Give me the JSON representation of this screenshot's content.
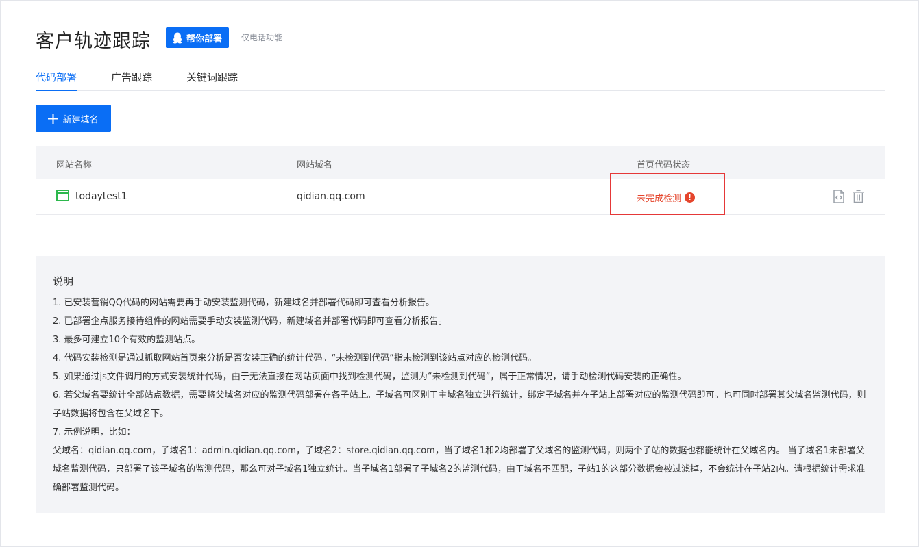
{
  "page": {
    "title": "客户轨迹跟踪",
    "deploy_button": "帮你部署",
    "phone_note": "仅电话功能"
  },
  "tabs": [
    {
      "label": "代码部署",
      "active": true
    },
    {
      "label": "广告跟踪",
      "active": false
    },
    {
      "label": "关键词跟踪",
      "active": false
    }
  ],
  "new_domain_button": "新建域名",
  "table": {
    "columns": [
      "网站名称",
      "网站域名",
      "首页代码状态"
    ],
    "rows": [
      {
        "name": "todaytest1",
        "domain": "qidian.qq.com",
        "status": "未完成检测",
        "status_icon": "warning-icon"
      }
    ]
  },
  "notes": {
    "title": "说明",
    "lines": [
      "1. 已安装营销QQ代码的网站需要再手动安装监测代码，新建域名并部署代码即可查看分析报告。",
      "2. 已部署企点服务接待组件的网站需要手动安装监测代码，新建域名并部署代码即可查看分析报告。",
      "3. 最多可建立10个有效的监测站点。",
      "4. 代码安装检测是通过抓取网站首页来分析是否安装正确的统计代码。“未检测到代码”指未检测到该站点对应的检测代码。",
      "5. 如果通过js文件调用的方式安装统计代码，由于无法直接在网站页面中找到检测代码，监测为“未检测到代码”，属于正常情况，请手动检测代码安装的正确性。",
      "6. 若父域名要统计全部站点数据，需要将父域名对应的监测代码部署在各子站上。子域名可区别于主域名独立进行统计，绑定子域名并在子站上部署对应的监测代码即可。也可同时部署其父域名监测代码，则子站数据将包含在父域名下。",
      "7. 示例说明，比如：",
      "父域名：qidian.qq.com，子域名1：admin.qidian.qq.com，子域名2：store.qidian.qq.com，当子域名1和2均部署了父域名的监测代码，则两个子站的数据也都能统计在父域名内。 当子域名1未部署父域名监测代码，只部署了该子域名的监测代码，那么可对子域名1独立统计。当子域名1部署了子域名2的监测代码，由于域名不匹配，子站1的这部分数据会被过滤掉，不会统计在子站2内。请根据统计需求准确部署监测代码。"
    ]
  },
  "colors": {
    "accent": "#0a6ef5",
    "error": "#e5452c",
    "highlight_box": "#e53838",
    "site_icon": "#2db84d"
  }
}
